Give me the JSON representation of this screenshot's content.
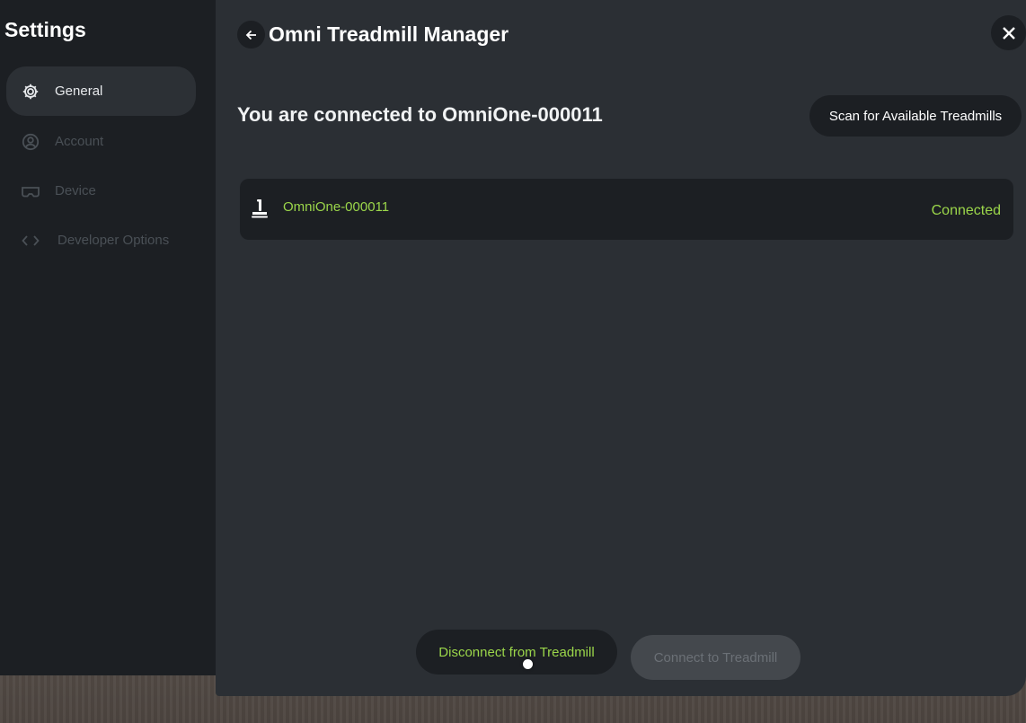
{
  "sidebar": {
    "title": "Settings",
    "items": [
      {
        "label": "General",
        "icon": "gear-icon",
        "active": true
      },
      {
        "label": "Account",
        "icon": "account-icon",
        "active": false
      },
      {
        "label": "Device",
        "icon": "headset-icon",
        "active": false
      },
      {
        "label": "Developer Options",
        "icon": "code-icon",
        "active": false
      }
    ]
  },
  "header": {
    "title": "Omni Treadmill Manager"
  },
  "main": {
    "heading": "You are connected to OmniOne-000011",
    "scan_button": "Scan for Available Treadmills",
    "devices": [
      {
        "name": "OmniOne-000011",
        "status": "Connected",
        "icon": "treadmill-icon"
      }
    ],
    "disconnect_button": "Disconnect from Treadmill",
    "connect_button": "Connect to Treadmill"
  },
  "colors": {
    "accent_green": "#9bd64a",
    "panel": "#2b2f34",
    "sidebar": "#1c1f23"
  }
}
